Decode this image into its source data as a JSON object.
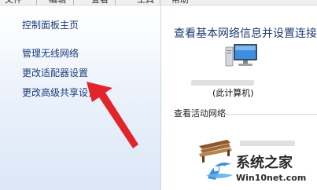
{
  "menu": [
    "文件",
    "编辑",
    "查看",
    "工具",
    "帮助"
  ],
  "sidebar": {
    "items": [
      {
        "label": "控制面板主页"
      },
      {
        "label": "管理无线网络"
      },
      {
        "label": "更改适配器设置"
      },
      {
        "label": "更改高级共享设置"
      }
    ]
  },
  "main": {
    "title": "查看基本网络信息并设置连接",
    "computer_label": "(此计算机)",
    "active_networks_label": "查看活动网络"
  },
  "watermark": {
    "name": "系统之家",
    "url": "Win10net.com"
  },
  "annotation": {
    "color": "#e2252b"
  },
  "colors": {
    "link": "#1a3d7c",
    "title": "#1e3a72"
  },
  "icons": [
    "computer-icon",
    "network-bench-icon",
    "watermark-logo-icon"
  ]
}
